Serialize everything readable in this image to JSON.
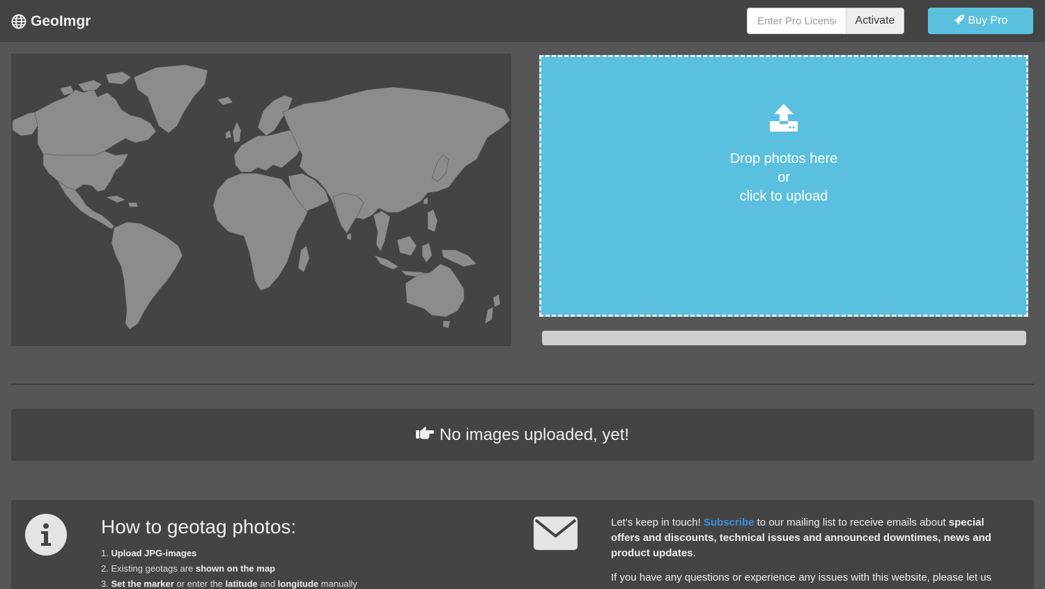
{
  "navbar": {
    "brand": "GeoImgr",
    "brand_icon": "globe-icon",
    "license_placeholder": "Enter Pro License",
    "activate_label": "Activate",
    "buy_label": "Buy Pro",
    "buy_icon": "rocket-icon"
  },
  "dropzone": {
    "icon": "upload-icon",
    "line1": "Drop photos here",
    "line2": "or",
    "line3": "click to upload"
  },
  "progress": {
    "value": 0
  },
  "notice": {
    "icon": "hand-pointing-right-icon",
    "text": "No images uploaded, yet!"
  },
  "howto": {
    "icon": "info-icon",
    "title": "How to geotag photos:",
    "steps": [
      {
        "num": "1.",
        "bold": "Upload JPG-images",
        "rest": ""
      },
      {
        "num": "2.",
        "pre": "Existing geotags are ",
        "bold": "shown on the map"
      },
      {
        "num": "3.",
        "bold1": "Set the marker",
        "mid1": " or enter the ",
        "bold2": "latitude",
        "mid2": " and ",
        "bold3": "longitude",
        "rest": " manually"
      }
    ]
  },
  "newsletter": {
    "icon": "envelope-icon",
    "intro": "Let's keep in touch! ",
    "subscribe_link": "Subscribe",
    "mid": " to our mailing list to receive emails about ",
    "bold": "special offers and discounts, technical issues and announced downtimes, news and product updates",
    "end": ".",
    "contact": "If you have any questions or experience any issues with this website, please let us"
  },
  "colors": {
    "background": "#565656",
    "panel": "#444444",
    "accent": "#5bc0de",
    "land": "#8c8c8c",
    "link": "#3a8fe0"
  }
}
